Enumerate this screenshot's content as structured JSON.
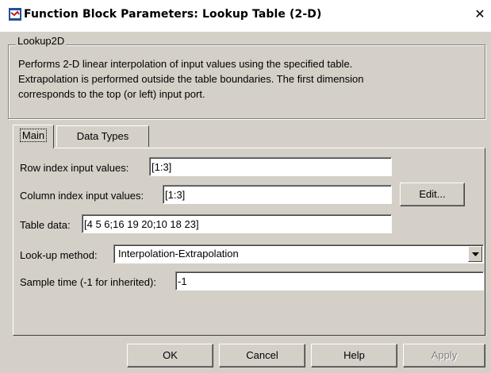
{
  "window": {
    "title": "Function Block Parameters: Lookup Table (2-D)",
    "close_glyph": "✕"
  },
  "group": {
    "legend": "Lookup2D",
    "description_lines": [
      "Performs 2-D linear interpolation of input values using the specified table.",
      "Extrapolation is performed outside the table boundaries.  The first dimension",
      "corresponds to the top (or left) input port."
    ]
  },
  "tabs": [
    {
      "label": "Main",
      "active": true
    },
    {
      "label": "Data Types",
      "active": false
    }
  ],
  "fields": {
    "row_index": {
      "label": "Row index input values:",
      "value": "[1:3]"
    },
    "column_index": {
      "label": "Column index input values:",
      "value": "[1:3]"
    },
    "edit_button": "Edit...",
    "table_data": {
      "label": "Table data:",
      "value": "[4 5 6;16 19 20;10 18 23]"
    },
    "lookup_method": {
      "label": "Look-up method:",
      "value": "Interpolation-Extrapolation"
    },
    "sample_time": {
      "label": "Sample time (-1 for inherited):",
      "value": "-1"
    }
  },
  "buttons": {
    "ok": "OK",
    "cancel": "Cancel",
    "help": "Help",
    "apply": "Apply"
  },
  "icons": {
    "app": "simulink-block-icon",
    "close": "close-icon",
    "dropdown": "chevron-down-icon"
  }
}
